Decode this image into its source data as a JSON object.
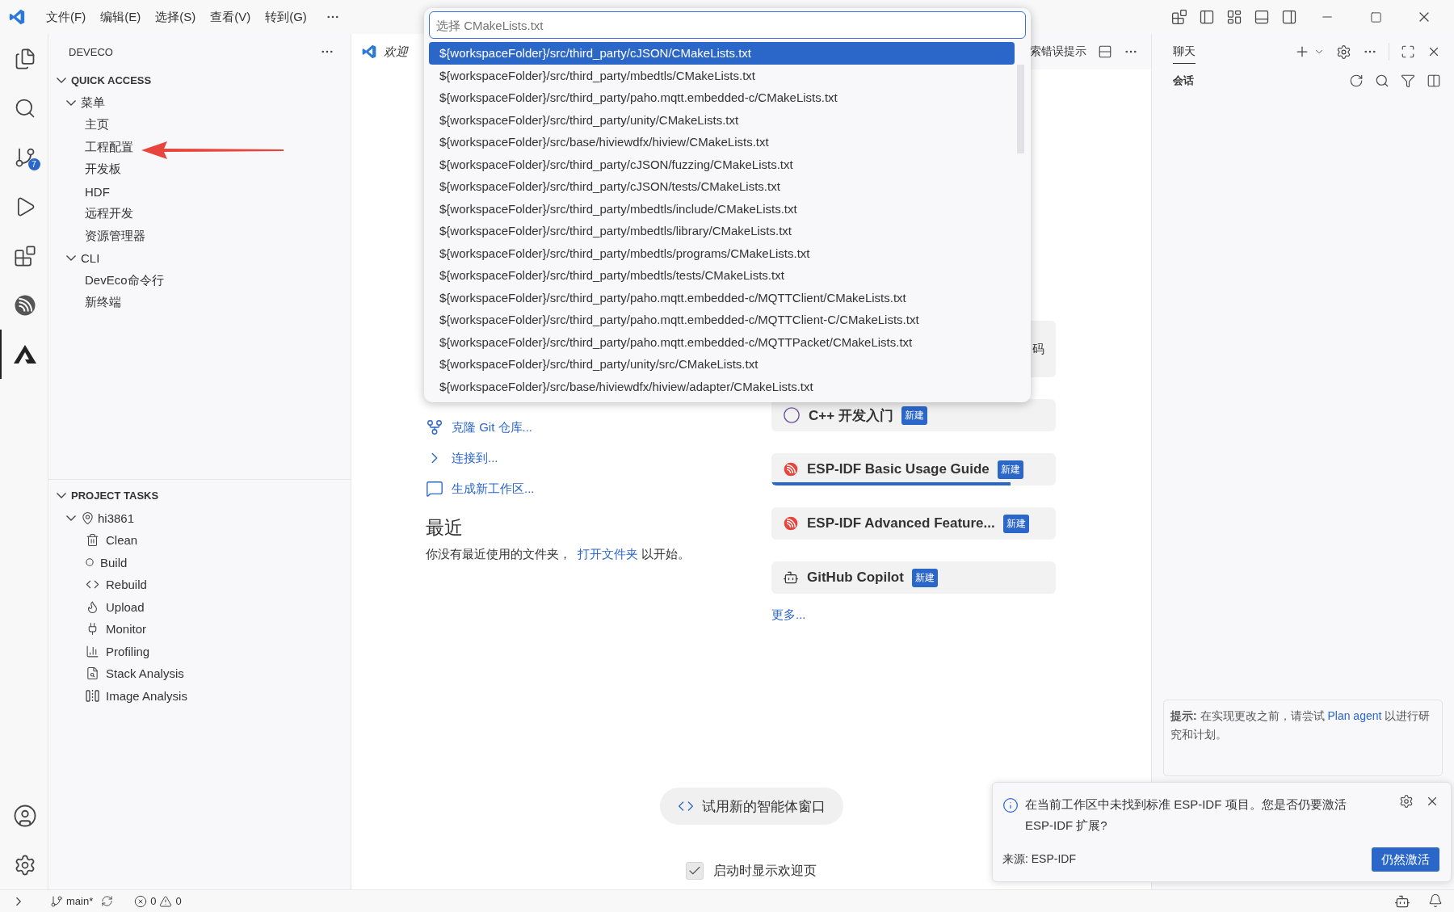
{
  "title_bar": {
    "menus": [
      "文件(F)",
      "编辑(E)",
      "选择(S)",
      "查看(V)",
      "转到(G)"
    ]
  },
  "activity_bar": {
    "items": [
      {
        "kind": "files",
        "selected": false
      },
      {
        "kind": "search",
        "selected": false
      },
      {
        "kind": "source_control",
        "selected": false,
        "badge": "7"
      },
      {
        "kind": "run",
        "selected": false
      },
      {
        "kind": "extensions",
        "selected": false
      },
      {
        "kind": "espressif",
        "selected": false
      },
      {
        "kind": "deveco",
        "selected": true
      }
    ]
  },
  "sidebar": {
    "title": "DEVECO",
    "sections": [
      {
        "title": "QUICK ACCESS",
        "expanded": true,
        "items": [
          {
            "label": "菜单",
            "expanded": true,
            "children": [
              {
                "label": "主页"
              },
              {
                "label": "工程配置"
              },
              {
                "label": "开发板"
              },
              {
                "label": "HDF"
              },
              {
                "label": "远程开发"
              },
              {
                "label": "资源管理器"
              }
            ]
          },
          {
            "label": "CLI",
            "expanded": true,
            "children": [
              {
                "label": "DevEco命令行"
              },
              {
                "label": "新终端"
              }
            ]
          }
        ]
      },
      {
        "title": "PROJECT TASKS",
        "expanded": true,
        "items": [
          {
            "label": "hi3861",
            "kind": "project",
            "expanded": true,
            "children": [
              {
                "label": "Clean",
                "kind": "clean"
              },
              {
                "label": "Build",
                "kind": "build"
              },
              {
                "label": "Rebuild",
                "kind": "rebuild"
              },
              {
                "label": "Upload",
                "kind": "upload"
              },
              {
                "label": "Monitor",
                "kind": "monitor"
              },
              {
                "label": "Profiling",
                "kind": "profiling"
              },
              {
                "label": "Stack Analysis",
                "kind": "stack"
              },
              {
                "label": "Image Analysis",
                "kind": "image"
              }
            ]
          }
        ]
      }
    ]
  },
  "editor": {
    "tabs": [
      {
        "label": "欢迎",
        "selected": true
      }
    ],
    "tab_fragment": "索错误提示",
    "start_links": [
      {
        "label": "克隆 Git 仓库...",
        "kind": "clone"
      },
      {
        "label": "连接到...",
        "kind": "remote"
      },
      {
        "label": "生成新工作区...",
        "kind": "generate"
      }
    ],
    "recent": {
      "title": "最近",
      "before": "你没有最近使用的文件夹，",
      "link": "打开文件夹",
      "after": "以开始。"
    },
    "walkthroughs": [
      {
        "title": "码",
        "kind": "covered"
      },
      {
        "title": "C++ 开发入门",
        "kind": "cpp",
        "badge": "新建"
      },
      {
        "title": "ESP-IDF Basic Usage Guide",
        "kind": "espressif",
        "badge": "新建",
        "level": 0.84
      },
      {
        "title": "ESP-IDF Advanced Feature...",
        "kind": "espressif",
        "badge": "新建"
      },
      {
        "title": "GitHub Copilot",
        "kind": "copilot",
        "badge": "新建"
      }
    ],
    "more_link": "更多...",
    "agent_button": "试用新的智能体窗口",
    "show_on_startup": {
      "label": "启动时显示欢迎页",
      "checked": true
    }
  },
  "quick_pick": {
    "placeholder": "选择 CMakeLists.txt",
    "items": [
      {
        "label": "${workspaceFolder}/src/third_party/cJSON/CMakeLists.txt",
        "selected": true
      },
      {
        "label": "${workspaceFolder}/src/third_party/mbedtls/CMakeLists.txt",
        "selected": false
      },
      {
        "label": "${workspaceFolder}/src/third_party/paho.mqtt.embedded-c/CMakeLists.txt",
        "selected": false
      },
      {
        "label": "${workspaceFolder}/src/third_party/unity/CMakeLists.txt",
        "selected": false
      },
      {
        "label": "${workspaceFolder}/src/base/hiviewdfx/hiview/CMakeLists.txt",
        "selected": false
      },
      {
        "label": "${workspaceFolder}/src/third_party/cJSON/fuzzing/CMakeLists.txt",
        "selected": false
      },
      {
        "label": "${workspaceFolder}/src/third_party/cJSON/tests/CMakeLists.txt",
        "selected": false
      },
      {
        "label": "${workspaceFolder}/src/third_party/mbedtls/include/CMakeLists.txt",
        "selected": false
      },
      {
        "label": "${workspaceFolder}/src/third_party/mbedtls/library/CMakeLists.txt",
        "selected": false
      },
      {
        "label": "${workspaceFolder}/src/third_party/mbedtls/programs/CMakeLists.txt",
        "selected": false
      },
      {
        "label": "${workspaceFolder}/src/third_party/mbedtls/tests/CMakeLists.txt",
        "selected": false
      },
      {
        "label": "${workspaceFolder}/src/third_party/paho.mqtt.embedded-c/MQTTClient/CMakeLists.txt",
        "selected": false
      },
      {
        "label": "${workspaceFolder}/src/third_party/paho.mqtt.embedded-c/MQTTClient-C/CMakeLists.txt",
        "selected": false
      },
      {
        "label": "${workspaceFolder}/src/third_party/paho.mqtt.embedded-c/MQTTPacket/CMakeLists.txt",
        "selected": false
      },
      {
        "label": "${workspaceFolder}/src/third_party/unity/src/CMakeLists.txt",
        "selected": false
      },
      {
        "label": "${workspaceFolder}/src/base/hiviewdfx/hiview/adapter/CMakeLists.txt",
        "selected": false
      }
    ]
  },
  "chat": {
    "tabs": [
      {
        "label": "聊天",
        "selected": true
      }
    ],
    "section": "会话",
    "tip": {
      "label": "提示:",
      "before": "在实现更改之前，请尝试",
      "link": "Plan agent",
      "after": "以进行研究和计划。"
    }
  },
  "notification": {
    "message": "在当前工作区中未找到标准 ESP-IDF 项目。您是否仍要激活 ESP-IDF 扩展?",
    "source": "来源: ESP-IDF",
    "button": "仍然激活"
  },
  "status_bar": {
    "branch": "main*",
    "errors": "0",
    "warnings": "0"
  }
}
